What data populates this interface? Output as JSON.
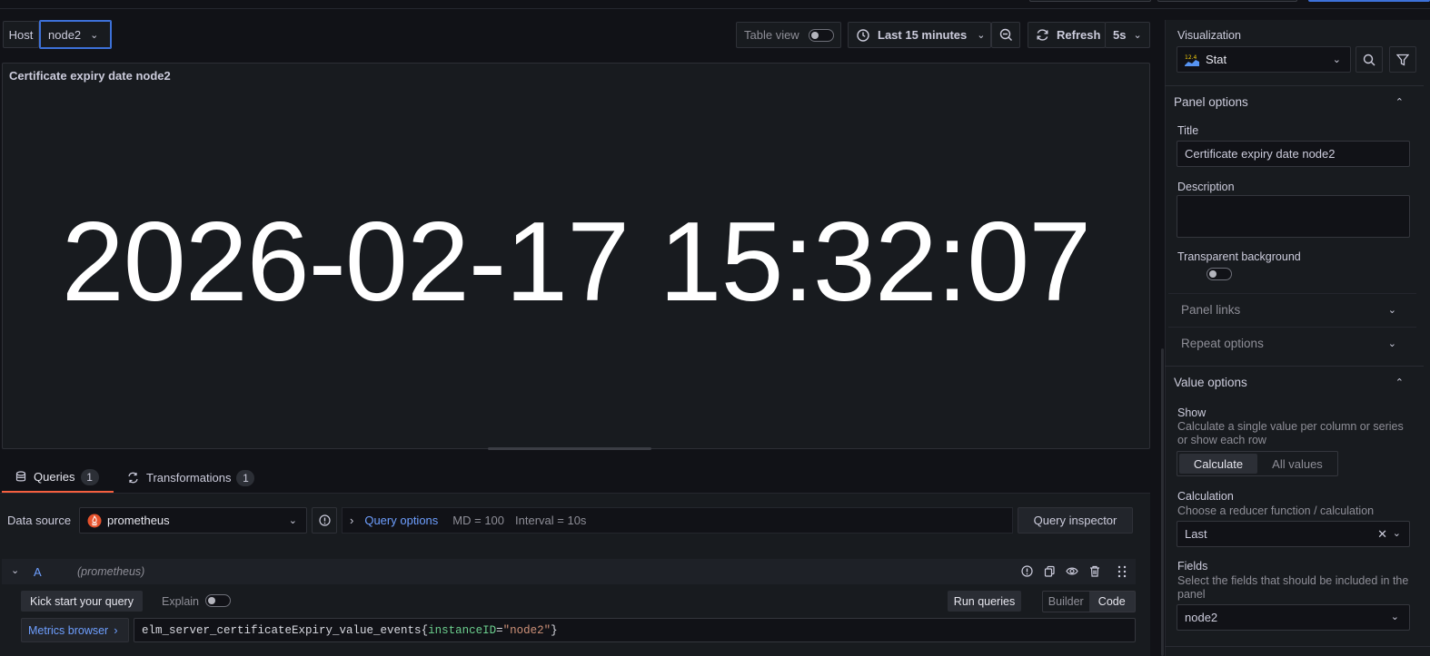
{
  "toolbar": {
    "host_label": "Host",
    "host_value": "node2",
    "table_view_label": "Table view",
    "time_range": "Last 15 minutes",
    "refresh_label": "Refresh",
    "refresh_interval": "5s"
  },
  "panel": {
    "title": "Certificate expiry date node2",
    "stat_value": "2026-02-17 15:32:07"
  },
  "tabs": {
    "queries_label": "Queries",
    "queries_count": "1",
    "transformations_label": "Transformations",
    "transformations_count": "1"
  },
  "datasource": {
    "label": "Data source",
    "value": "prometheus",
    "query_options_label": "Query options",
    "md": "MD = 100",
    "interval": "Interval = 10s",
    "query_inspector_label": "Query inspector"
  },
  "query": {
    "ref_id": "A",
    "ds_name": "(prometheus)",
    "kick_start_label": "Kick start your query",
    "explain_label": "Explain",
    "run_queries_label": "Run queries",
    "builder_label": "Builder",
    "code_label": "Code",
    "metrics_browser_label": "Metrics browser",
    "expr_metric": "elm_server_certificateExpiry_value_events",
    "expr_open": "{",
    "expr_label_key": "instanceID",
    "expr_eq": "=",
    "expr_label_value": "\"node2\"",
    "expr_close": "}"
  },
  "options": {
    "visualization_label": "Visualization",
    "visualization_value": "Stat",
    "panel_options_label": "Panel options",
    "title_label": "Title",
    "title_value": "Certificate expiry date node2",
    "description_label": "Description",
    "transparent_label": "Transparent background",
    "panel_links_label": "Panel links",
    "repeat_options_label": "Repeat options",
    "value_options_label": "Value options",
    "show_label": "Show",
    "show_desc": "Calculate a single value per column or series or show each row",
    "calculate_label": "Calculate",
    "all_values_label": "All values",
    "calculation_label": "Calculation",
    "calculation_desc": "Choose a reducer function / calculation",
    "calculation_value": "Last",
    "fields_label": "Fields",
    "fields_desc": "Select the fields that should be included in the panel",
    "fields_value": "node2"
  },
  "colors": {
    "background": "#111217",
    "panel": "#181b1f",
    "accent_blue": "#6e9fff",
    "label_green": "#6ccf8e",
    "string_orange": "#ce9178",
    "active_tab": "#f55f3e"
  }
}
